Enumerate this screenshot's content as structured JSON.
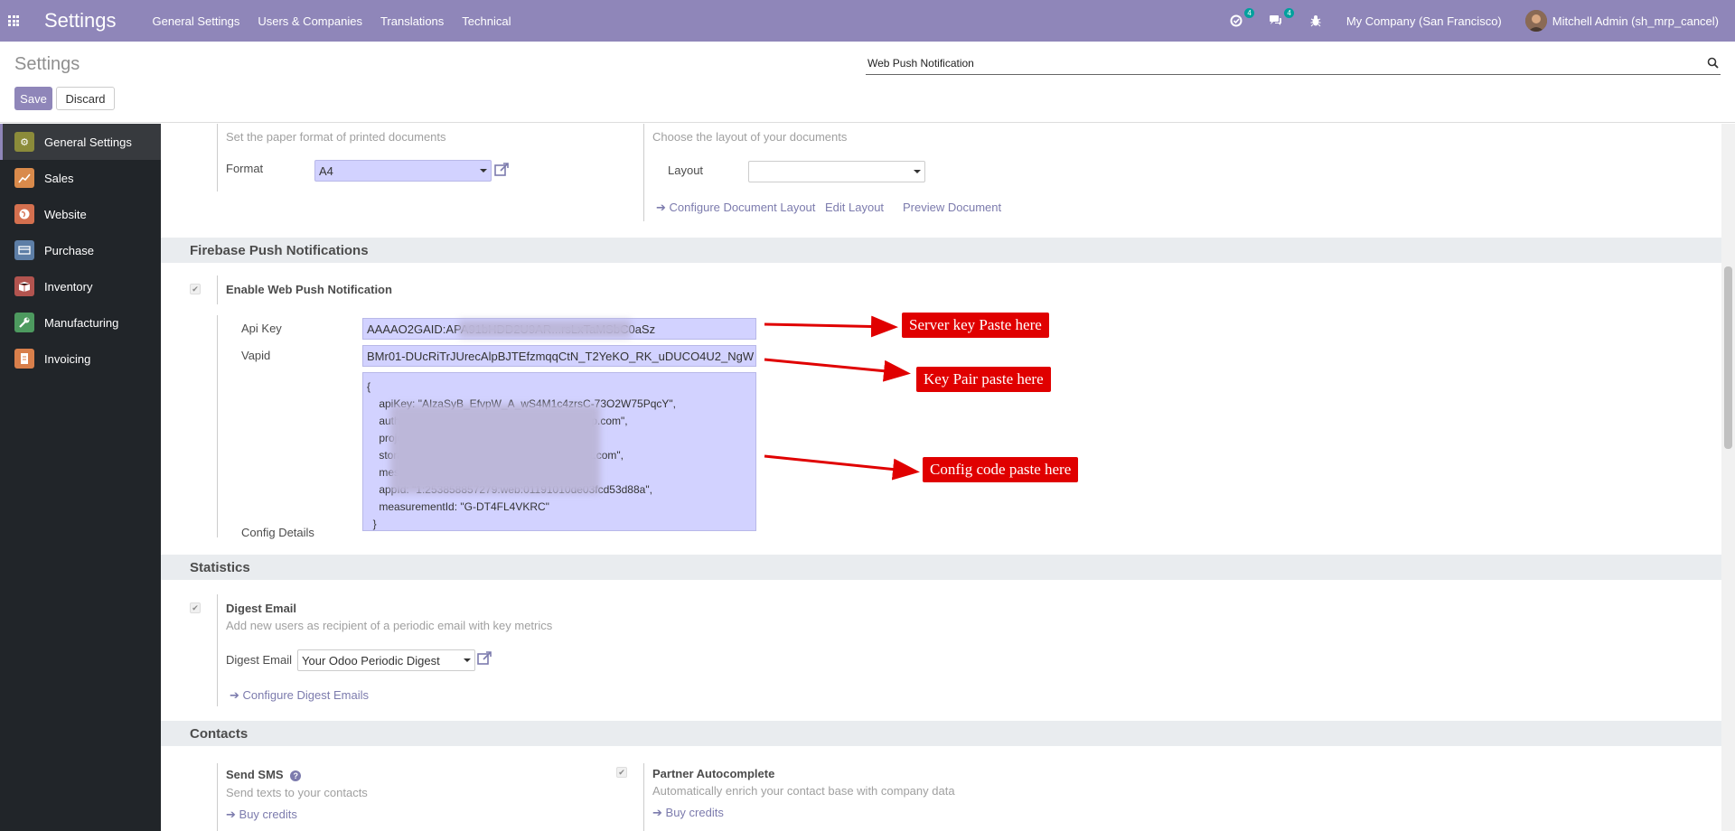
{
  "navbar": {
    "brand": "Settings",
    "menu": [
      "General Settings",
      "Users & Companies",
      "Translations",
      "Technical"
    ],
    "activity_badge": "4",
    "messages_badge": "4",
    "company": "My Company (San Francisco)",
    "user": "Mitchell Admin (sh_mrp_cancel)"
  },
  "control_panel": {
    "title": "Settings",
    "save_label": "Save",
    "discard_label": "Discard",
    "search_value": "Web Push Notification"
  },
  "sidebar": {
    "items": [
      {
        "label": "General Settings",
        "icon": "gear-icon",
        "color": "#8b8b3a",
        "active": true
      },
      {
        "label": "Sales",
        "icon": "sales-chart-icon",
        "color": "#d98a4b"
      },
      {
        "label": "Website",
        "icon": "globe-icon",
        "color": "#d4704f"
      },
      {
        "label": "Purchase",
        "icon": "purchase-icon",
        "color": "#5d7ea6"
      },
      {
        "label": "Inventory",
        "icon": "box-icon",
        "color": "#b2544f"
      },
      {
        "label": "Manufacturing",
        "icon": "wrench-icon",
        "color": "#4d9a5f"
      },
      {
        "label": "Invoicing",
        "icon": "invoice-icon",
        "color": "#d87f4b"
      }
    ]
  },
  "document_layout": {
    "paper_format_desc": "Set the paper format of printed documents",
    "format_label": "Format",
    "format_value": "A4",
    "layout_desc": "Choose the layout of your documents",
    "layout_label": "Layout",
    "layout_value": "",
    "configure_link": "Configure Document Layout",
    "edit_link": "Edit Layout",
    "preview_link": "Preview Document"
  },
  "firebase": {
    "section_title": "Firebase Push Notifications",
    "enable_label": "Enable Web Push Notification",
    "api_key_label": "Api Key",
    "api_key_value": "AAAAO2GAID:APA91bHDD2U9AR...rsLxTaMSbC0aSz",
    "vapid_label": "Vapid",
    "vapid_value": "BMr01-DUcRiTrJUrecAlpBJTEfzmqqCtN_T2YeKO_RK_uDUCO4U2_NgW",
    "config_label": "Config Details",
    "config_lines": [
      "{",
      "    apiKey: \"AIzaSyB_EfvpW_A_wS4M1c4zrsC-73O2W75PqcY\",",
      "    authDomain: \"                              .firebaseapp.com\",",
      "    projectId: \"",
      "    storageBucket: \"                           10.appspot.com\",",
      "    messagingSenderId: \"",
      "    appId: \"1:253858857279:web:01191010de03fcd53d88a\",",
      "    measurementId: \"G-DT4FL4VKRC\"",
      "  }"
    ]
  },
  "callouts": {
    "server_key": "Server key Paste here",
    "key_pair": "Key Pair paste here",
    "config_code": "Config code paste here"
  },
  "statistics": {
    "section_title": "Statistics",
    "digest_title": "Digest Email",
    "digest_desc": "Add new users as recipient of a periodic email with key metrics",
    "digest_label": "Digest Email",
    "digest_value": "Your Odoo Periodic Digest",
    "configure_link": "Configure Digest Emails"
  },
  "contacts": {
    "section_title": "Contacts",
    "sms_title": "Send SMS",
    "sms_desc": "Send texts to your contacts",
    "sms_link": "Buy credits",
    "partner_title": "Partner Autocomplete",
    "partner_desc": "Automatically enrich your contact base with company data",
    "partner_link": "Buy credits"
  }
}
